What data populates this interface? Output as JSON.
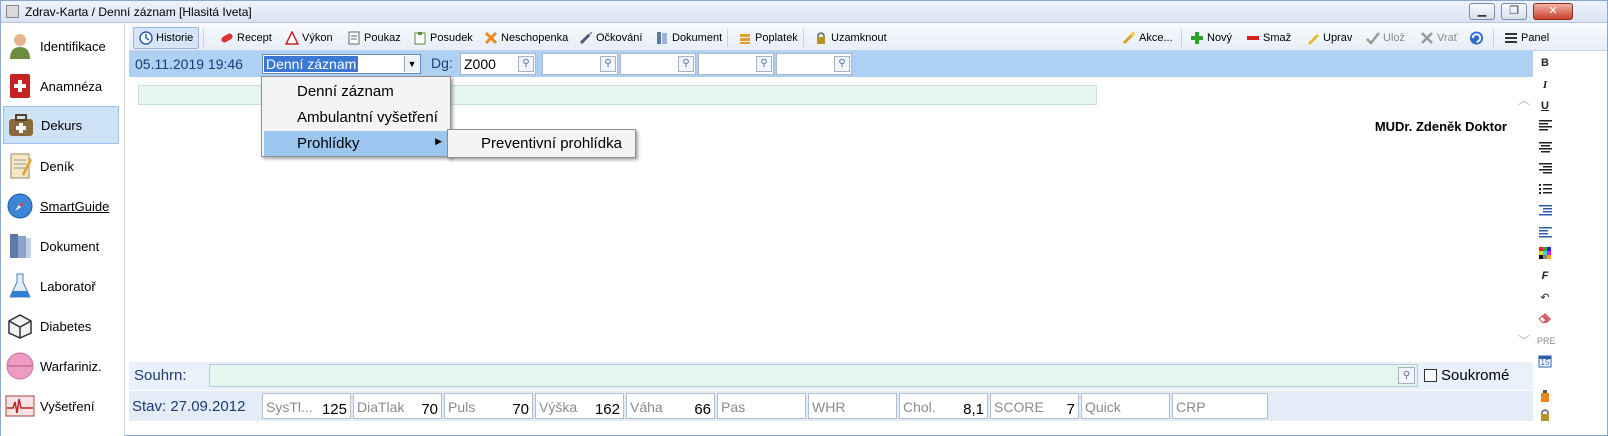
{
  "window": {
    "title": "Zdrav-Karta / Denní záznam [Hlasitá  Iveta]",
    "minimize": "▁",
    "restore": "❐",
    "close": "✕"
  },
  "sidebar": {
    "items": [
      {
        "label": "Identifikace",
        "icon": "person-icon"
      },
      {
        "label": "Anamnéza",
        "icon": "first-aid-icon"
      },
      {
        "label": "Dekurs",
        "icon": "medical-bag-icon",
        "active": true
      },
      {
        "label": "Deník",
        "icon": "notebook-icon"
      },
      {
        "label": "SmartGuide",
        "icon": "compass-icon"
      },
      {
        "label": "Dokument",
        "icon": "binder-icon"
      },
      {
        "label": "Laboratoř",
        "icon": "flask-icon"
      },
      {
        "label": "Diabetes",
        "icon": "cube-icon"
      },
      {
        "label": "Warfariniz.",
        "icon": "pill-icon"
      },
      {
        "label": "Vyšetření",
        "icon": "ecg-icon"
      }
    ]
  },
  "toolbar": {
    "historie": "Historie",
    "recept": "Recept",
    "vykon": "Výkon",
    "poukaz": "Poukaz",
    "posudek": "Posudek",
    "neschopenka": "Neschopenka",
    "ockovani": "Očkování",
    "dokument": "Dokument",
    "poplatek": "Poplatek",
    "uzamknout": "Uzamknout",
    "akce": "Akce...",
    "novy": "Nový",
    "smaz": "Smaž",
    "uprav": "Uprav",
    "uloz": "Ulož",
    "vrat": "Vrať",
    "panel": "Panel"
  },
  "header": {
    "datetime": "05.11.2019 19:46",
    "record_type": "Denní záznam",
    "dg_label": "Dg:",
    "dg_values": [
      "Z000",
      "",
      "",
      "",
      ""
    ]
  },
  "dropdown": {
    "items": [
      "Denní záznam",
      "Ambulantní vyšetření",
      "Prohlídky"
    ],
    "highlighted": "Prohlídky",
    "submenu_items": [
      "Preventivní prohlídka"
    ]
  },
  "editor": {
    "doctor": "MUDr. Zdeněk Doktor"
  },
  "format_panel": {
    "items": [
      "B",
      "I",
      "U",
      "align-left",
      "align-center",
      "align-right",
      "bullets",
      "indent",
      "outdent",
      "color",
      "F",
      "undo",
      "eraser",
      "PRE",
      "calendar",
      "bottle",
      "lock"
    ],
    "pre_label": "PRE",
    "cal_label": "15"
  },
  "souhrn": {
    "label": "Souhrn:",
    "value": "",
    "private_label": "Soukromé",
    "private_checked": false
  },
  "status": {
    "stav": "Stav: 27.09.2012",
    "vitals": [
      {
        "label": "SysTl...",
        "value": "125"
      },
      {
        "label": "DiaTlak",
        "value": "70"
      },
      {
        "label": "Puls",
        "value": "70"
      },
      {
        "label": "Výška",
        "value": "162"
      },
      {
        "label": "Váha",
        "value": "66"
      },
      {
        "label": "Pas",
        "value": ""
      },
      {
        "label": "WHR",
        "value": ""
      },
      {
        "label": "Chol.",
        "value": "8,1"
      },
      {
        "label": "SCORE",
        "value": "7"
      },
      {
        "label": "Quick",
        "value": ""
      },
      {
        "label": "CRP",
        "value": ""
      }
    ]
  }
}
